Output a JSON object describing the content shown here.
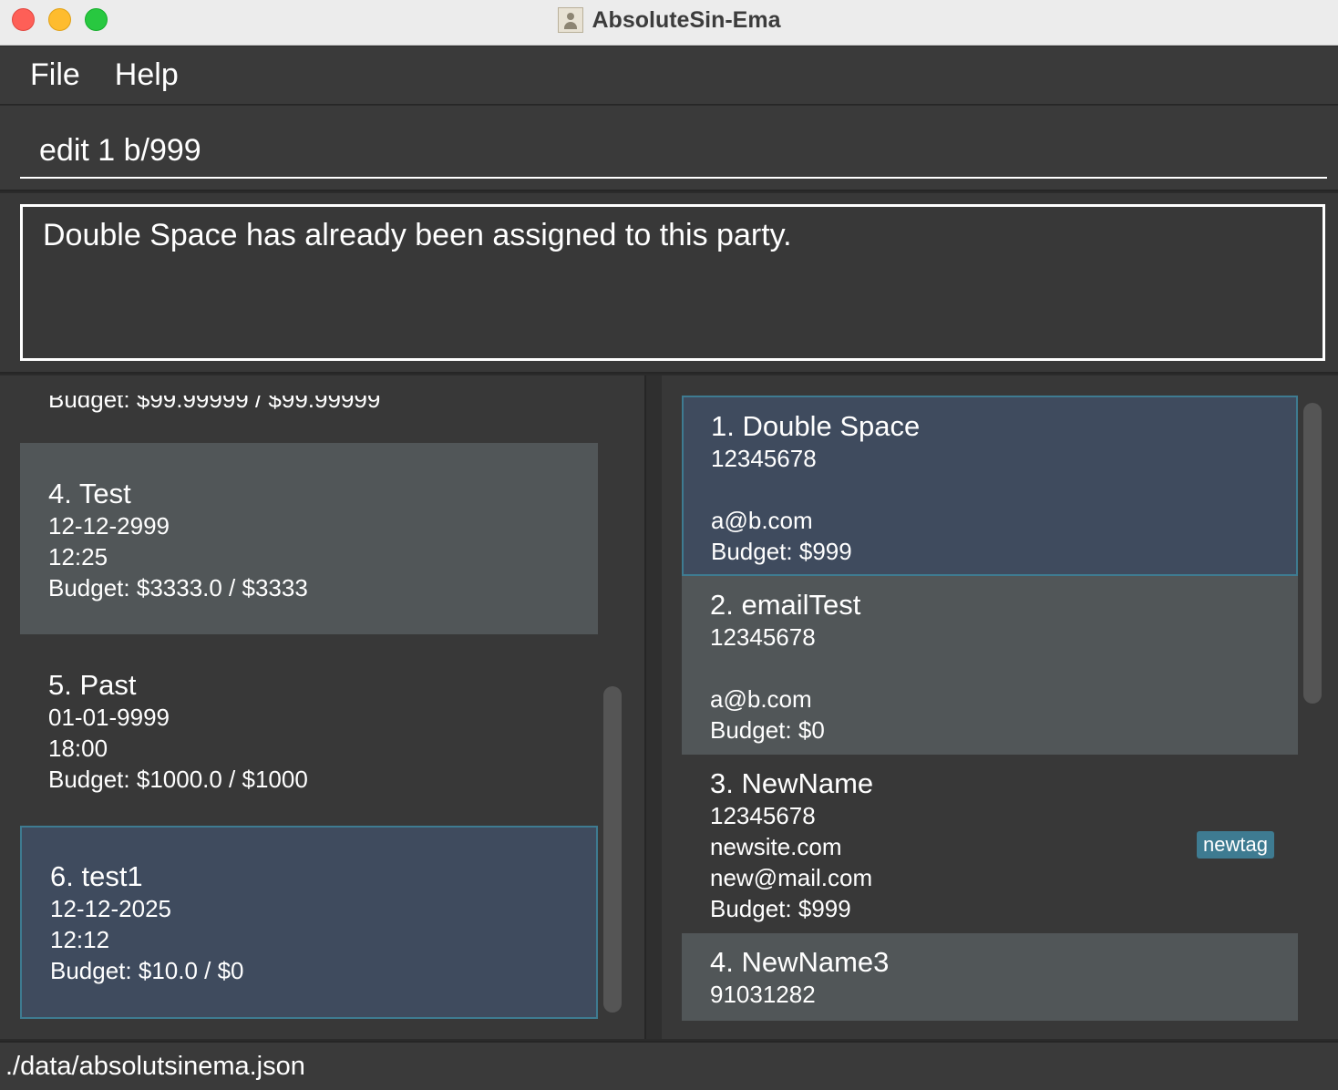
{
  "window": {
    "title": "AbsoluteSin-Ema"
  },
  "menu": {
    "items": [
      "File",
      "Help"
    ]
  },
  "command": {
    "value": "edit 1 b/999"
  },
  "result": {
    "message": "Double Space has already been assigned to this party."
  },
  "events": {
    "partial_top": "Budget: $99.99999 / $99.99999",
    "items": [
      {
        "name": "4. Test",
        "date": "12-12-2999",
        "time": "12:25",
        "budget": "Budget: $3333.0 / $3333"
      },
      {
        "name": "5. Past",
        "date": "01-01-9999",
        "time": "18:00",
        "budget": "Budget: $1000.0 / $1000"
      },
      {
        "name": "6. test1",
        "date": "12-12-2025",
        "time": "12:12",
        "budget": "Budget: $10.0 / $0",
        "selected": true
      }
    ]
  },
  "contacts": {
    "items": [
      {
        "name": "1. Double Space",
        "phone": "12345678",
        "website": "",
        "email": "a@b.com",
        "budget": "Budget: $999",
        "selected": true
      },
      {
        "name": "2. emailTest",
        "phone": "12345678",
        "website": "",
        "email": "a@b.com",
        "budget": "Budget: $0"
      },
      {
        "name": "3. NewName",
        "phone": "12345678",
        "website": "newsite.com",
        "email": "new@mail.com",
        "budget": "Budget: $999",
        "tag": "newtag"
      },
      {
        "name": "4. NewName3",
        "phone": "91031282"
      }
    ]
  },
  "status": {
    "path": "./data/absolutsinema.json"
  },
  "colors": {
    "selected_bg": "#3f4b5e",
    "selected_border": "#3e7b91",
    "alt_row": "#515658",
    "tag_bg": "#3e7b91"
  }
}
